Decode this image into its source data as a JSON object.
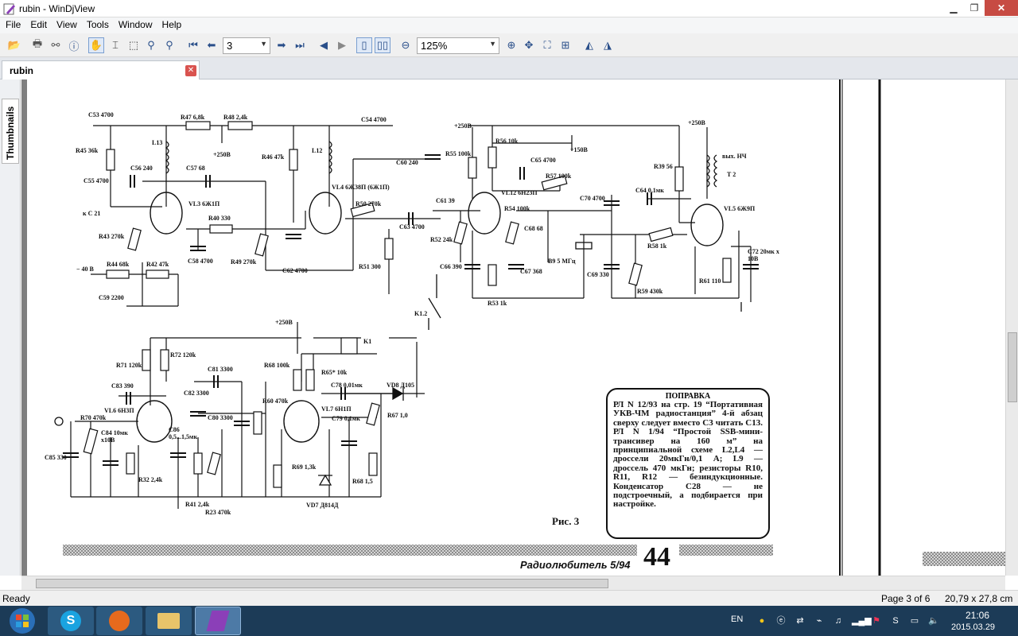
{
  "window": {
    "title": "rubin - WinDjView"
  },
  "menu": [
    "File",
    "Edit",
    "View",
    "Tools",
    "Window",
    "Help"
  ],
  "toolbar": {
    "page_number": "3",
    "zoom": "125%"
  },
  "tabs": [
    {
      "label": "rubin"
    }
  ],
  "sidebar": {
    "thumbnails_label": "Thumbnails"
  },
  "status": {
    "ready": "Ready",
    "page": "Page 3 of 6",
    "size": "20,79 x 27,8 cm"
  },
  "taskbar": {
    "lang": "EN",
    "time": "21:06",
    "date": "2015.03.29"
  },
  "schematic": {
    "labels": [
      {
        "id": "c53",
        "text": "C53 4700"
      },
      {
        "id": "r47",
        "text": "R47 6,8k"
      },
      {
        "id": "r48",
        "text": "R48 2,4k"
      },
      {
        "id": "c54",
        "text": "C54 4700"
      },
      {
        "id": "r45",
        "text": "R45 36k"
      },
      {
        "id": "l13",
        "text": "L13"
      },
      {
        "id": "p250a",
        "text": "+250B"
      },
      {
        "id": "r46",
        "text": "R46 47k"
      },
      {
        "id": "l12",
        "text": "L12"
      },
      {
        "id": "c56",
        "text": "C56 240"
      },
      {
        "id": "c57",
        "text": "C57 68"
      },
      {
        "id": "c55",
        "text": "C55 4700"
      },
      {
        "id": "vl3",
        "text": "VL3 6Ж1П"
      },
      {
        "id": "vl4",
        "text": "VL4 6Ж38П (6Ж1П)"
      },
      {
        "id": "kc21",
        "text": "к C 21"
      },
      {
        "id": "r40",
        "text": "R40 330"
      },
      {
        "id": "r50",
        "text": "R50 270k"
      },
      {
        "id": "c63",
        "text": "C63 4700"
      },
      {
        "id": "r43",
        "text": "R43 270k"
      },
      {
        "id": "c58",
        "text": "C58 4700"
      },
      {
        "id": "r49",
        "text": "R49 270k"
      },
      {
        "id": "c62",
        "text": "C62 4700"
      },
      {
        "id": "r44",
        "text": "R44 68k"
      },
      {
        "id": "r42",
        "text": "R42 47k"
      },
      {
        "id": "m40",
        "text": "− 40 B"
      },
      {
        "id": "c59",
        "text": "C59 2200"
      },
      {
        "id": "r51",
        "text": "R51 300"
      },
      {
        "id": "p250b",
        "text": "+250B"
      },
      {
        "id": "r56",
        "text": "R56 10k"
      },
      {
        "id": "p150",
        "text": "+150B"
      },
      {
        "id": "r55",
        "text": "R55 100k"
      },
      {
        "id": "c60",
        "text": "C60 240"
      },
      {
        "id": "c65",
        "text": "C65 4700"
      },
      {
        "id": "r57",
        "text": "R57 100k"
      },
      {
        "id": "vl12",
        "text": "VL12 6Н23П"
      },
      {
        "id": "c61",
        "text": "C61 39"
      },
      {
        "id": "r54",
        "text": "R54 100k"
      },
      {
        "id": "c70",
        "text": "C70 4700"
      },
      {
        "id": "r52",
        "text": "R52 24k"
      },
      {
        "id": "c68",
        "text": "C68 68"
      },
      {
        "id": "b9",
        "text": "B9 5 МГц"
      },
      {
        "id": "c66",
        "text": "C66 390"
      },
      {
        "id": "c67",
        "text": "C67 368"
      },
      {
        "id": "c69",
        "text": "C69 330"
      },
      {
        "id": "r53",
        "text": "R53 1k"
      },
      {
        "id": "k12",
        "text": "K1.2"
      },
      {
        "id": "p250c",
        "text": "+250B"
      },
      {
        "id": "vihnch",
        "text": "вых. НЧ"
      },
      {
        "id": "r39",
        "text": "R39 56"
      },
      {
        "id": "t2",
        "text": "T 2"
      },
      {
        "id": "c64",
        "text": "C64 0,1мк"
      },
      {
        "id": "vl5",
        "text": "VL5 6Ж9П"
      },
      {
        "id": "r58",
        "text": "R58 1k"
      },
      {
        "id": "r59",
        "text": "R59 430k"
      },
      {
        "id": "c72",
        "text": "C72 20мк х 10B"
      },
      {
        "id": "r61",
        "text": "R61 110"
      },
      {
        "id": "p250d",
        "text": "+250B"
      },
      {
        "id": "k1",
        "text": "K1"
      },
      {
        "id": "r71",
        "text": "R71 120k"
      },
      {
        "id": "r72",
        "text": "R72 120k"
      },
      {
        "id": "c81",
        "text": "C81 3300"
      },
      {
        "id": "r68",
        "text": "R68 100k"
      },
      {
        "id": "r65",
        "text": "R65* 10k"
      },
      {
        "id": "c83",
        "text": "C83 390"
      },
      {
        "id": "c82",
        "text": "C82 3300"
      },
      {
        "id": "c78",
        "text": "C78 0,01мк"
      },
      {
        "id": "vd8",
        "text": "VD8 Д105"
      },
      {
        "id": "vl6",
        "text": "VL6 6Н3П"
      },
      {
        "id": "r60",
        "text": "R60 470k"
      },
      {
        "id": "vl7",
        "text": "VL7 6Н1П"
      },
      {
        "id": "c80",
        "text": "C80 3300"
      },
      {
        "id": "c79",
        "text": "C79 0,1мк"
      },
      {
        "id": "r67",
        "text": "R67 1,0"
      },
      {
        "id": "r70",
        "text": "R70 470k"
      },
      {
        "id": "c84",
        "text": "C84 10мк х10B"
      },
      {
        "id": "c86",
        "text": "C86 0,5...1,5мк"
      },
      {
        "id": "c85",
        "text": "C85 330"
      },
      {
        "id": "r32",
        "text": "R32 2,4k"
      },
      {
        "id": "r69",
        "text": "R69 1,3k"
      },
      {
        "id": "r68b",
        "text": "R68 1,5"
      },
      {
        "id": "r41",
        "text": "R41 2,4k"
      },
      {
        "id": "r23",
        "text": "R23 470k"
      },
      {
        "id": "vd7",
        "text": "VD7 Д814Д"
      },
      {
        "id": "fig",
        "text": "Рис. 3"
      }
    ],
    "correction": {
      "heading": "ПОПРАВКА",
      "body": "РЛ N 12/93 на стр. 19 “Портативная УКВ-ЧМ радиостанция” 4-й абзац сверху следует вместо С3 читать С13. РЛ N 1/94 “Простой SSB-мини-трансивер на 160 м” на принципиальной схеме L2,L4 — дроссели 20мкГн/0,1 А; L9 — дроссель 470 мкГн; резисторы R10, R11, R12 — безиндукционные. Конденсатор С28 — не подстроечный, а подбирается при настройке."
    },
    "footer": {
      "magazine": "Радиолюбитель 5/94",
      "page_num": "44"
    }
  }
}
